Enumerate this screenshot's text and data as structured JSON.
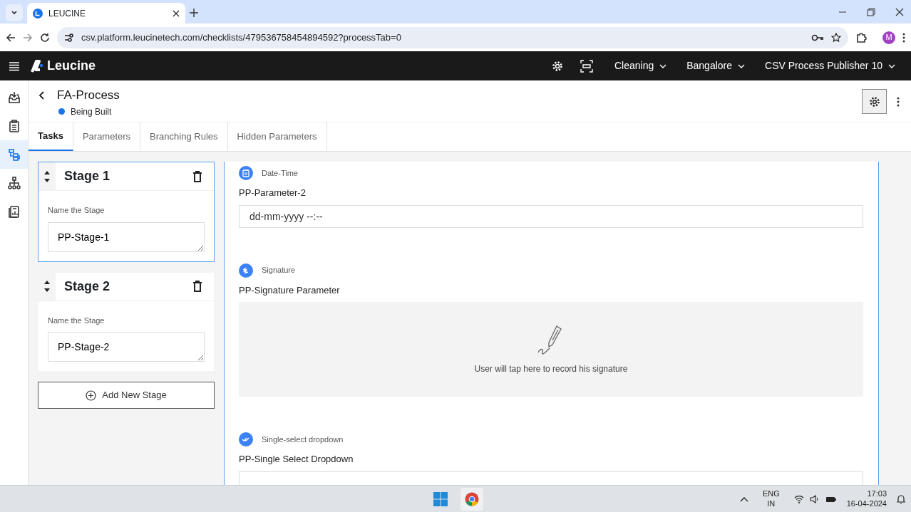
{
  "browser": {
    "tab_title": "LEUCINE",
    "url": "csv.platform.leucinetech.com/checklists/479536758454894592?processTab=0",
    "profile_initial": "M"
  },
  "header": {
    "brand": "Leucine",
    "menus": [
      "Cleaning",
      "Bangalore",
      "CSV Process Publisher 10"
    ]
  },
  "sidebar": {
    "items": [
      {
        "selected": false
      },
      {
        "selected": false
      },
      {
        "selected": true
      },
      {
        "selected": false
      },
      {
        "selected": false
      }
    ]
  },
  "process": {
    "title": "FA-Process",
    "status": {
      "text": "Being Built",
      "color": "#1a73e8"
    }
  },
  "tabs": [
    {
      "label": "Tasks",
      "selected": true
    },
    {
      "label": "Parameters",
      "selected": false
    },
    {
      "label": "Branching Rules",
      "selected": false
    },
    {
      "label": "Hidden Parameters",
      "selected": false
    }
  ],
  "stages": [
    {
      "title": "Stage 1",
      "field_label": "Name the Stage",
      "value": "PP-Stage-1",
      "selected": true
    },
    {
      "title": "Stage 2",
      "field_label": "Name the Stage",
      "value": "PP-Stage-2",
      "selected": false
    }
  ],
  "add_stage": "Add New Stage",
  "parameters": [
    {
      "kind": "datetime",
      "type_label": "Date-Time",
      "name": "PP-Parameter-2",
      "placeholder": "dd-mm-yyyy --:--"
    },
    {
      "kind": "signature",
      "type_label": "Signature",
      "name": "PP-Signature Parameter",
      "hint": "User will tap here to record his signature"
    },
    {
      "kind": "dropdown",
      "type_label": "Single-select dropdown",
      "name": "PP-Single Select Dropdown"
    }
  ],
  "taskbar": {
    "language": "ENG",
    "region": "IN",
    "time": "17:03",
    "date": "16-04-2024"
  }
}
